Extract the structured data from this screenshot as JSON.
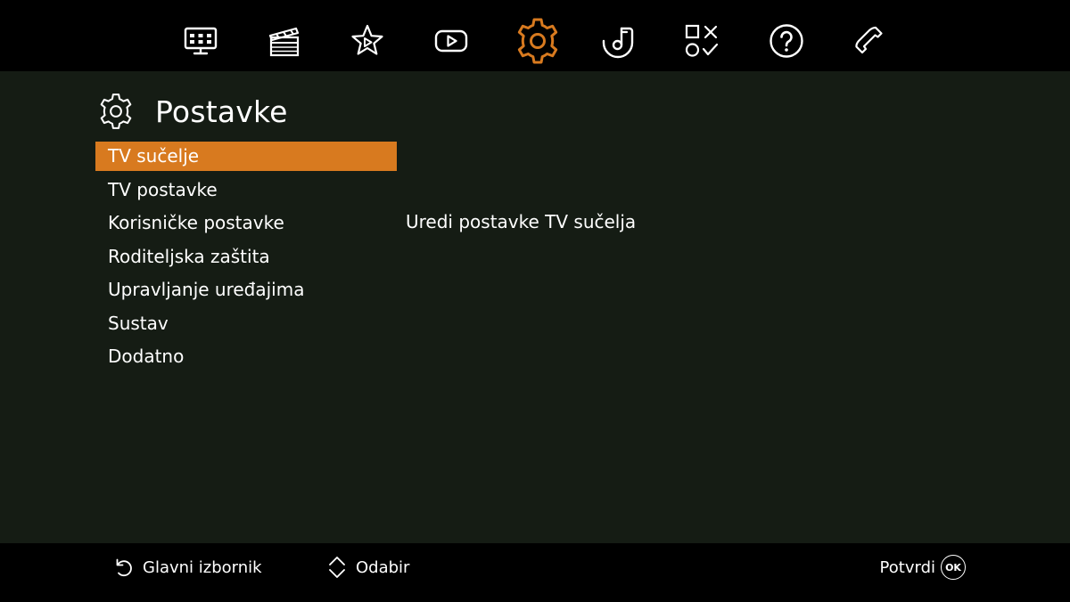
{
  "colors": {
    "background": "#151c14",
    "bar": "#000000",
    "accent": "#d87a1f",
    "text": "#ffffff"
  },
  "nav": {
    "items": [
      {
        "name": "tv-guide",
        "icon": "tv-grid-icon",
        "active": false
      },
      {
        "name": "movies",
        "icon": "clapperboard-icon",
        "active": false
      },
      {
        "name": "favorites",
        "icon": "star-play-icon",
        "active": false
      },
      {
        "name": "video",
        "icon": "play-button-icon",
        "active": false
      },
      {
        "name": "settings",
        "icon": "gear-icon",
        "active": true
      },
      {
        "name": "music",
        "icon": "music-note-icon",
        "active": false
      },
      {
        "name": "games",
        "icon": "games-icon",
        "active": false
      },
      {
        "name": "help",
        "icon": "question-icon",
        "active": false
      },
      {
        "name": "phone",
        "icon": "phone-icon",
        "active": false
      }
    ]
  },
  "header": {
    "icon": "gear-icon",
    "title": "Postavke"
  },
  "menu": {
    "selected_index": 0,
    "items": [
      {
        "label": "TV sučelje"
      },
      {
        "label": "TV postavke"
      },
      {
        "label": "Korisničke postavke"
      },
      {
        "label": "Roditeljska zaštita"
      },
      {
        "label": "Upravljanje uređajima"
      },
      {
        "label": "Sustav"
      },
      {
        "label": "Dodatno"
      }
    ]
  },
  "description": {
    "text": "Uredi postavke TV sučelja"
  },
  "footer": {
    "back": {
      "icon": "undo-arrow-icon",
      "label": "Glavni izbornik"
    },
    "select": {
      "icon": "up-down-chevron-icon",
      "label": "Odabir"
    },
    "confirm": {
      "label": "Potvrdi",
      "badge": "OK"
    }
  }
}
